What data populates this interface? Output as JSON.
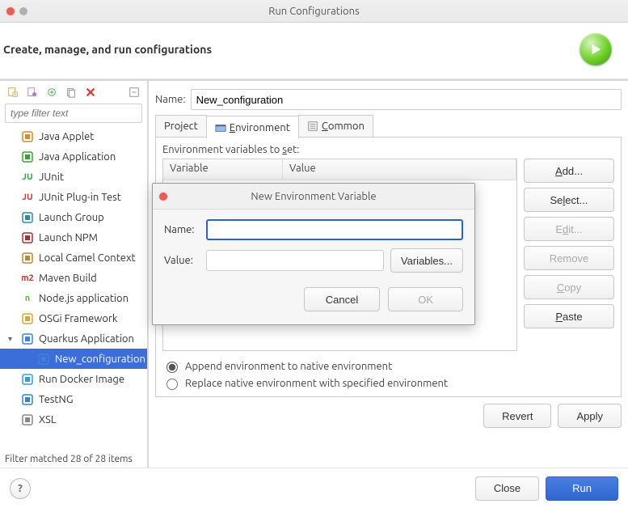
{
  "window": {
    "title": "Run Configurations",
    "subtitle": "Create, manage, and run configurations"
  },
  "filter": {
    "placeholder": "type filter text",
    "status": "Filter matched 28 of 28 items"
  },
  "tree": {
    "items": [
      {
        "label": "Java Applet",
        "icon_color": "#d48b2a"
      },
      {
        "label": "Java Application",
        "icon_color": "#3aa13a"
      },
      {
        "label": "JUnit",
        "icon_text": "JU",
        "icon_color": "#35a03a"
      },
      {
        "label": "JUnit Plug-in Test",
        "icon_text": "JU",
        "icon_color": "#c23a3a"
      },
      {
        "label": "Launch Group",
        "icon_color": "#2a8ea0"
      },
      {
        "label": "Launch NPM",
        "icon_color": "#a03333"
      },
      {
        "label": "Local Camel Context",
        "icon_color": "#b58a3a"
      },
      {
        "label": "Maven Build",
        "icon_text": "m2",
        "icon_color": "#c0392b"
      },
      {
        "label": "Node.js application",
        "icon_text": "n",
        "icon_color": "#6ab04c"
      },
      {
        "label": "OSGi Framework",
        "icon_color": "#d4a837"
      },
      {
        "label": "Quarkus Application",
        "icon_color": "#4182d8",
        "expandable": true
      },
      {
        "label": "New_configuration",
        "icon_color": "#4182d8",
        "indent": true,
        "selected": true
      },
      {
        "label": "Run Docker Image",
        "icon_color": "#31a0d6"
      },
      {
        "label": "TestNG",
        "icon_color": "#3984c5"
      },
      {
        "label": "XSL",
        "icon_color": "#888"
      }
    ]
  },
  "config": {
    "name_label": "Name:",
    "name_value": "New_configuration",
    "tabs": {
      "project": "Project",
      "environment": "Environment",
      "common": "Common"
    },
    "env": {
      "set_label": "Environment variables to set:",
      "col_variable": "Variable",
      "col_value": "Value",
      "buttons": {
        "add": "Add...",
        "select": "Select...",
        "edit": "Edit...",
        "remove": "Remove",
        "copy": "Copy",
        "paste": "Paste"
      },
      "radio_append": "Append environment to native environment",
      "radio_replace": "Replace native environment with specified environment"
    },
    "revert": "Revert",
    "apply": "Apply"
  },
  "bottom": {
    "close": "Close",
    "run": "Run"
  },
  "dialog": {
    "title": "New Environment Variable",
    "name_label": "Name:",
    "name_value": "",
    "value_label": "Value:",
    "value_value": "",
    "variables_btn": "Variables...",
    "cancel": "Cancel",
    "ok": "OK"
  }
}
